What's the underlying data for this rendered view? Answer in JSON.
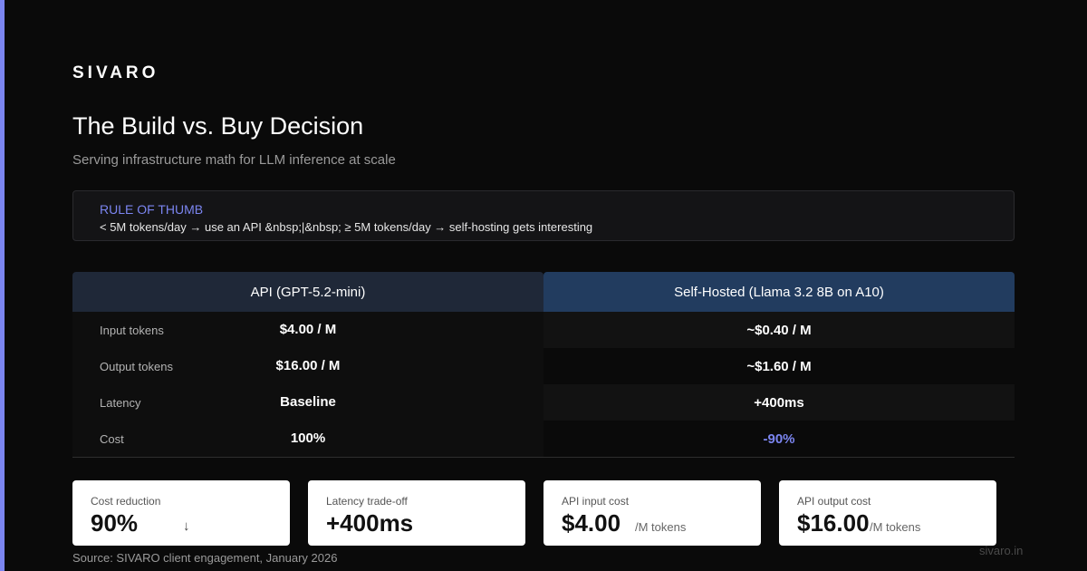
{
  "brand": {
    "logo": "SIVARO",
    "domain": "sivaro.in",
    "accent_color": "#7b85f0"
  },
  "header": {
    "title": "The Build vs. Buy Decision",
    "subtitle": "Serving infrastructure math for LLM inference at scale"
  },
  "rule": {
    "label": "RULE OF THUMB",
    "text": "< 5M tokens/day → use an API &nbsp;|&nbsp; ≥ 5M tokens/day → self-hosting gets interesting"
  },
  "comparison": {
    "columns": [
      "API (GPT-5.2-mini)",
      "Self-Hosted (Llama 3.2 8B on A10)"
    ],
    "rows": [
      {
        "label": "Input tokens",
        "api": "$4.00 / M",
        "self": "~$0.40 / M"
      },
      {
        "label": "Output tokens",
        "api": "$16.00 / M",
        "self": "~$1.60 / M"
      },
      {
        "label": "Latency",
        "api": "Baseline",
        "self": "+400ms"
      },
      {
        "label": "Cost",
        "api": "100%",
        "self": "-90%"
      }
    ]
  },
  "stats": [
    {
      "label": "Cost reduction",
      "value": "90%",
      "unit": "",
      "icon": "down-arrow-icon",
      "icon_glyph": "↓"
    },
    {
      "label": "Latency trade-off",
      "value": "+400ms",
      "unit": ""
    },
    {
      "label": "API input cost",
      "value": "$4.00",
      "unit": "/M tokens"
    },
    {
      "label": "API output cost",
      "value": "$16.00",
      "unit": "/M tokens"
    }
  ],
  "footer": {
    "source": "Source: SIVARO client engagement, January 2026"
  }
}
